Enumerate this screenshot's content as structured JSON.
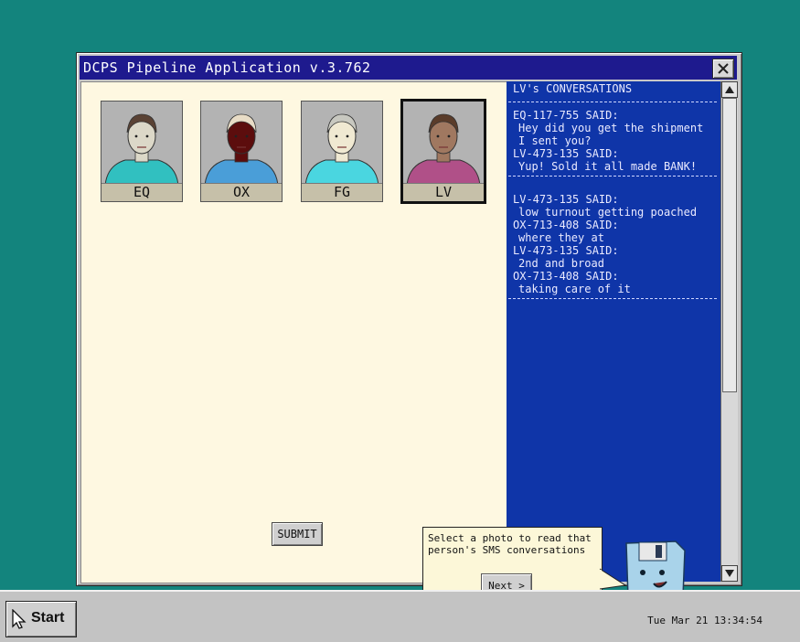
{
  "window": {
    "title": "DCPS Pipeline Application v.3.762"
  },
  "photos": [
    {
      "label": "EQ",
      "skin": "#dcd8c8",
      "hair": "#5a4234",
      "shirt": "#31c0c0",
      "selected": false
    },
    {
      "label": "OX",
      "skin": "#5c0d0d",
      "hair": "#e8dcc6",
      "shirt": "#4a9ed8",
      "selected": false
    },
    {
      "label": "FG",
      "skin": "#f0e9d2",
      "hair": "#c8c8c0",
      "shirt": "#4ad6e0",
      "selected": false
    },
    {
      "label": "LV",
      "skin": "#a07860",
      "hair": "#5a3c2a",
      "shirt": "#b05088",
      "selected": true
    }
  ],
  "submit_label": "SUBMIT",
  "conversations": {
    "title": "LV's CONVERSATIONS",
    "blocks": [
      [
        {
          "sender": "EQ-117-755 SAID:",
          "message": "Hey did you get the shipment I sent you?"
        },
        {
          "sender": "LV-473-135 SAID:",
          "message": "Yup! Sold it all made BANK!"
        }
      ],
      [
        {
          "sender": "LV-473-135 SAID:",
          "message": "low turnout getting poached"
        },
        {
          "sender": "OX-713-408 SAID:",
          "message": "where they at"
        },
        {
          "sender": "LV-473-135 SAID:",
          "message": "2nd and broad"
        },
        {
          "sender": "OX-713-408 SAID:",
          "message": "taking care of it"
        }
      ]
    ]
  },
  "tooltip": {
    "text": "Select a photo to read that person's SMS conversations",
    "next_label": "Next >"
  },
  "taskbar": {
    "start_label": "Start",
    "clock": "Tue Mar 21 13:34:54"
  },
  "colors": {
    "desktop": "#13847d",
    "titlebar": "#1e1a8e",
    "left_pane": "#fef8e1",
    "right_pane": "#0f35a8"
  },
  "icons": {
    "close": "close-icon",
    "scroll_up": "arrow-up-icon",
    "scroll_down": "arrow-down-icon",
    "cursor": "cursor-icon",
    "assistant": "floppy-disk-assistant-icon"
  }
}
